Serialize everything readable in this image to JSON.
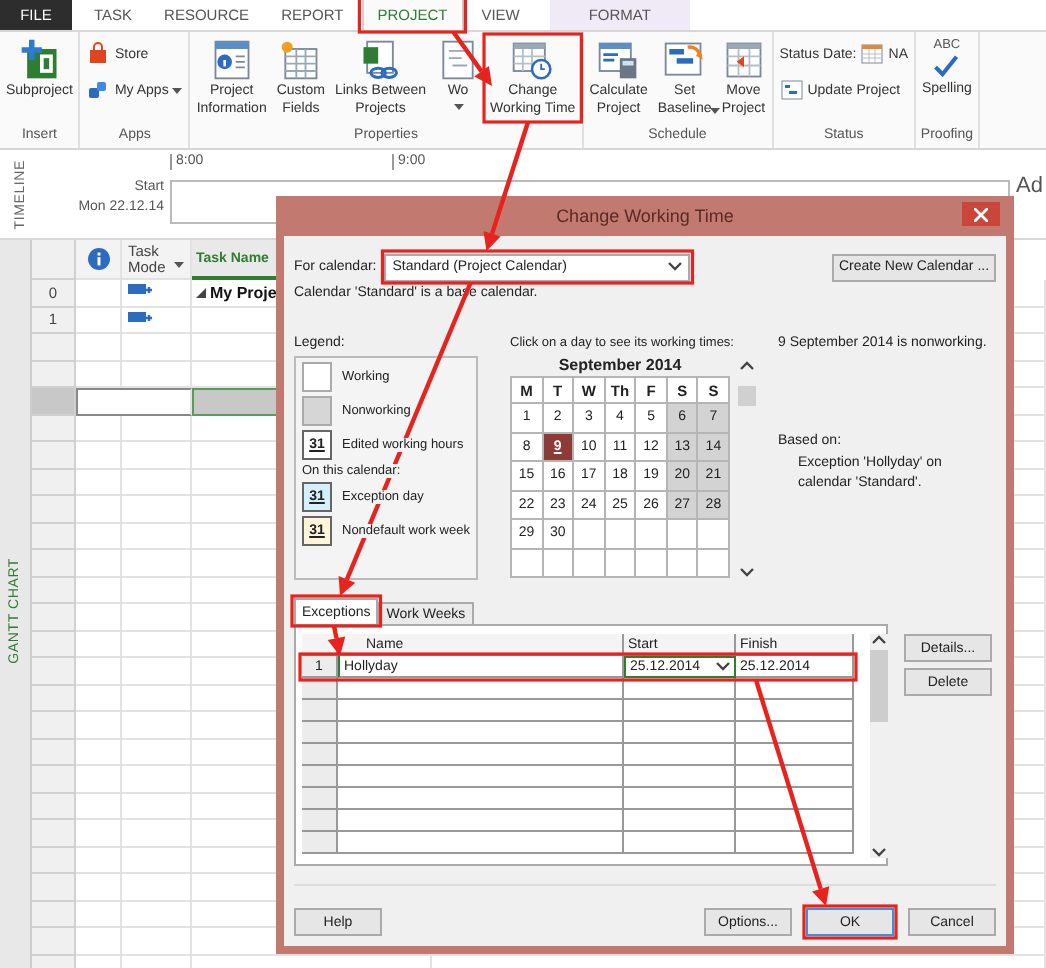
{
  "ribbon_tabs": [
    {
      "label": "FILE",
      "kind": "file",
      "selected": false
    },
    {
      "label": "TASK",
      "kind": "tab",
      "selected": false
    },
    {
      "label": "RESOURCE",
      "kind": "tab",
      "selected": false
    },
    {
      "label": "REPORT",
      "kind": "tab",
      "selected": false
    },
    {
      "label": "PROJECT",
      "kind": "tab",
      "selected": true
    },
    {
      "label": "VIEW",
      "kind": "tab",
      "selected": false
    }
  ],
  "contextual_tab": {
    "label": "FORMAT"
  },
  "ribbon_groups": [
    {
      "label": "Insert",
      "buttons": [
        {
          "kind": "large",
          "lines": [
            "Subproject"
          ],
          "caret": false
        }
      ]
    },
    {
      "label": "Apps",
      "buttons": [
        {
          "kind": "small",
          "lines": [
            "Store"
          ],
          "caret": false
        },
        {
          "kind": "small",
          "lines": [
            "My Apps"
          ],
          "caret": true
        }
      ]
    },
    {
      "label": "Properties",
      "buttons": [
        {
          "kind": "large",
          "lines": [
            "Project",
            "Information"
          ],
          "caret": false
        },
        {
          "kind": "large",
          "lines": [
            "Custom",
            "Fields"
          ],
          "caret": false
        },
        {
          "kind": "large",
          "lines": [
            "Links Between",
            "Projects"
          ],
          "caret": false
        },
        {
          "kind": "large",
          "lines": [
            "Wo"
          ],
          "caret": true
        },
        {
          "kind": "large",
          "lines": [
            "Change",
            "Working Time"
          ],
          "caret": false
        }
      ]
    },
    {
      "label": "Schedule",
      "buttons": [
        {
          "kind": "large",
          "lines": [
            "Calculate",
            "Project"
          ],
          "caret": false
        },
        {
          "kind": "large",
          "lines": [
            "Set",
            "Baseline"
          ],
          "caret": true
        },
        {
          "kind": "large",
          "lines": [
            "Move",
            "Project"
          ],
          "caret": false
        }
      ]
    },
    {
      "label": "Status",
      "buttons": [
        {
          "kind": "status",
          "lines": [
            "Status Date:"
          ],
          "value": "NA"
        },
        {
          "kind": "small",
          "lines": [
            "Update Project"
          ],
          "caret": false
        }
      ]
    },
    {
      "label": "Proofing",
      "buttons": [
        {
          "kind": "large",
          "badge": "ABC",
          "lines": [
            "Spelling"
          ],
          "caret": false
        }
      ]
    }
  ],
  "timeline": {
    "label": "TIMELINE",
    "start_label": "Start",
    "start_date": "Mon 22.12.14",
    "ticks": [
      "8:00",
      "9:00"
    ],
    "edge_text": "Ad"
  },
  "grid": {
    "view_label": "GANTT CHART",
    "columns": [
      {
        "kind": "info"
      },
      {
        "kind": "text",
        "label": "Task Mode",
        "caret": true,
        "selected": false
      },
      {
        "kind": "text",
        "label": "Task Name",
        "caret": false,
        "selected": true
      }
    ],
    "rows": [
      {
        "id": "0",
        "mode_icon": true,
        "name": "My Proje",
        "summary": true,
        "selected": false
      },
      {
        "id": "1",
        "mode_icon": true,
        "selected": false
      },
      {
        "selected": false
      },
      {
        "selected": false
      },
      {
        "selected": true
      }
    ]
  },
  "dialog": {
    "title": "Change Working Time",
    "for_calendar_label": "For calendar:",
    "calendar_select": "Standard (Project Calendar)",
    "create_button": "Create New Calendar ...",
    "base_note": "Calendar 'Standard' is a base calendar.",
    "legend_title": "Legend:",
    "legend": [
      {
        "kind": "swatch",
        "color": "#ffffff",
        "label": "Working"
      },
      {
        "kind": "swatch",
        "color": "#d6d6d6",
        "label": "Nonworking"
      },
      {
        "kind": "day",
        "color": "#ffffff",
        "sample": "31",
        "label": "Edited working hours"
      },
      {
        "kind": "heading",
        "label": "On this calendar:"
      },
      {
        "kind": "day",
        "color": "#d4f0fb",
        "sample": "31",
        "label": "Exception day"
      },
      {
        "kind": "day",
        "color": "#fdf6d8",
        "sample": "31",
        "label": "Nondefault work week"
      }
    ],
    "click_hint": "Click on a day to see its working times:",
    "month": "September 2014",
    "weekdays": [
      "M",
      "T",
      "W",
      "Th",
      "F",
      "S",
      "S"
    ],
    "weeks": [
      [
        {
          "day": "1",
          "nonworking": false,
          "selected": false
        },
        {
          "day": "2",
          "nonworking": false,
          "selected": false
        },
        {
          "day": "3",
          "nonworking": false,
          "selected": false
        },
        {
          "day": "4",
          "nonworking": false,
          "selected": false
        },
        {
          "day": "5",
          "nonworking": false,
          "selected": false
        },
        {
          "day": "6",
          "nonworking": true,
          "selected": false
        },
        {
          "day": "7",
          "nonworking": true,
          "selected": false
        }
      ],
      [
        {
          "day": "8",
          "nonworking": false,
          "selected": false
        },
        {
          "day": "9",
          "nonworking": true,
          "selected": true
        },
        {
          "day": "10",
          "nonworking": false,
          "selected": false
        },
        {
          "day": "11",
          "nonworking": false,
          "selected": false
        },
        {
          "day": "12",
          "nonworking": false,
          "selected": false
        },
        {
          "day": "13",
          "nonworking": true,
          "selected": false
        },
        {
          "day": "14",
          "nonworking": true,
          "selected": false
        }
      ],
      [
        {
          "day": "15",
          "nonworking": false,
          "selected": false
        },
        {
          "day": "16",
          "nonworking": false,
          "selected": false
        },
        {
          "day": "17",
          "nonworking": false,
          "selected": false
        },
        {
          "day": "18",
          "nonworking": false,
          "selected": false
        },
        {
          "day": "19",
          "nonworking": false,
          "selected": false
        },
        {
          "day": "20",
          "nonworking": true,
          "selected": false
        },
        {
          "day": "21",
          "nonworking": true,
          "selected": false
        }
      ],
      [
        {
          "day": "22",
          "nonworking": false,
          "selected": false
        },
        {
          "day": "23",
          "nonworking": false,
          "selected": false
        },
        {
          "day": "24",
          "nonworking": false,
          "selected": false
        },
        {
          "day": "25",
          "nonworking": false,
          "selected": false
        },
        {
          "day": "26",
          "nonworking": false,
          "selected": false
        },
        {
          "day": "27",
          "nonworking": true,
          "selected": false
        },
        {
          "day": "28",
          "nonworking": true,
          "selected": false
        }
      ],
      [
        {
          "day": "29",
          "nonworking": false,
          "selected": false
        },
        {
          "day": "30",
          "nonworking": false,
          "selected": false
        }
      ]
    ],
    "day_info": "9 September 2014 is nonworking.",
    "based_on_label": "Based on:",
    "based_on": "Exception 'Hollyday' on calendar 'Standard'.",
    "tabs": [
      {
        "label": "Exceptions",
        "selected": true
      },
      {
        "label": "Work Weeks",
        "selected": false
      }
    ],
    "exceptions": {
      "columns": [
        "Name",
        "Start",
        "Finish"
      ],
      "rows": [
        {
          "num": "1",
          "name": "Hollyday",
          "start": "25.12.2014",
          "finish": "25.12.2014"
        }
      ]
    },
    "side_buttons": [
      "Details...",
      "Delete"
    ],
    "footer_buttons": [
      {
        "label": "Help",
        "default": false
      },
      {
        "label": "Options...",
        "default": false
      },
      {
        "label": "OK",
        "default": true
      },
      {
        "label": "Cancel",
        "default": false
      }
    ]
  }
}
